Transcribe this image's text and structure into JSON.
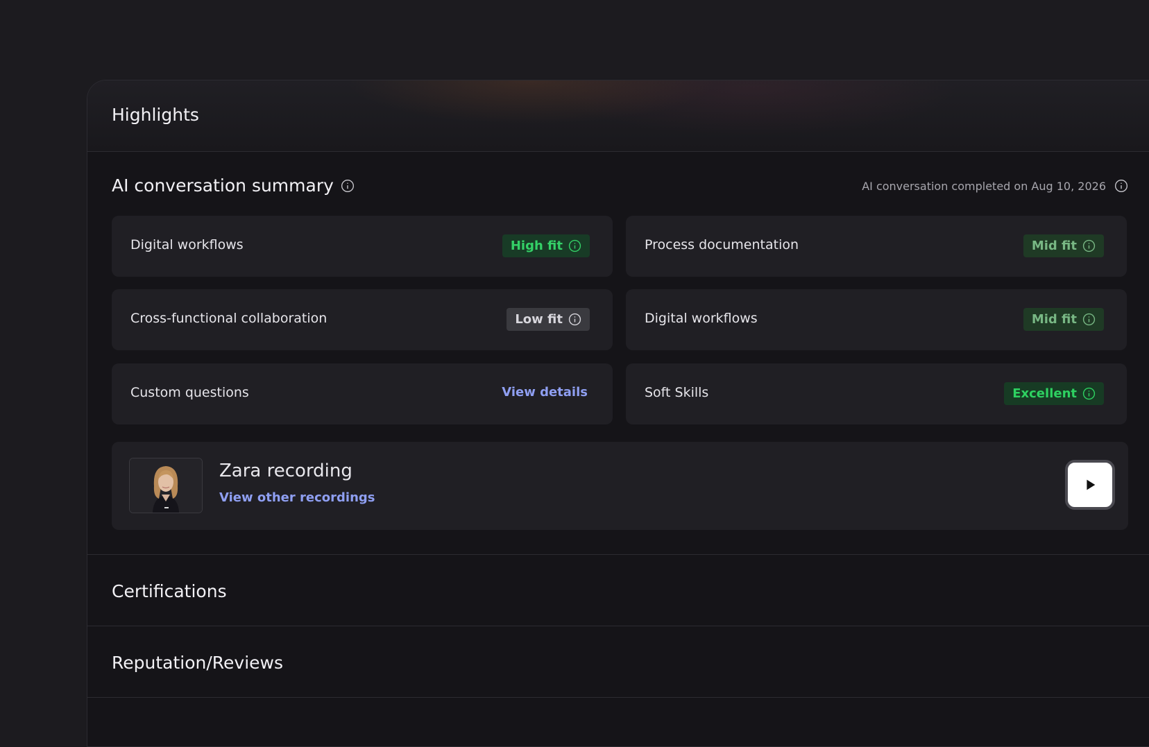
{
  "panel": {
    "title": "Highlights"
  },
  "ai_summary": {
    "title": "AI conversation summary",
    "completed_text": "AI conversation completed on Aug 10, 2026",
    "cards": [
      {
        "label": "Digital workflows",
        "badge": "High fit",
        "badge_type": "high"
      },
      {
        "label": "Process documentation",
        "badge": "Mid fit",
        "badge_type": "mid"
      },
      {
        "label": "Cross-functional collaboration",
        "badge": "Low fit",
        "badge_type": "low"
      },
      {
        "label": "Digital workflows",
        "badge": "Mid fit",
        "badge_type": "mid"
      },
      {
        "label": "Custom questions",
        "link": "View details"
      },
      {
        "label": "Soft Skills",
        "badge": "Excellent",
        "badge_type": "excellent"
      }
    ]
  },
  "recording": {
    "title": "Zara recording",
    "link": "View other recordings"
  },
  "sections": [
    {
      "title": "Certifications"
    },
    {
      "title": "Reputation/Reviews"
    }
  ],
  "colors": {
    "background": "#1c1b1f",
    "panel": "#151418",
    "card": "#201f24",
    "link": "#8f9ff2",
    "high_fit": "#34d067",
    "mid_fit": "#78b784",
    "low_fit": "#d7d6dc"
  },
  "icons": {
    "info": "info-icon",
    "play": "play-icon"
  }
}
